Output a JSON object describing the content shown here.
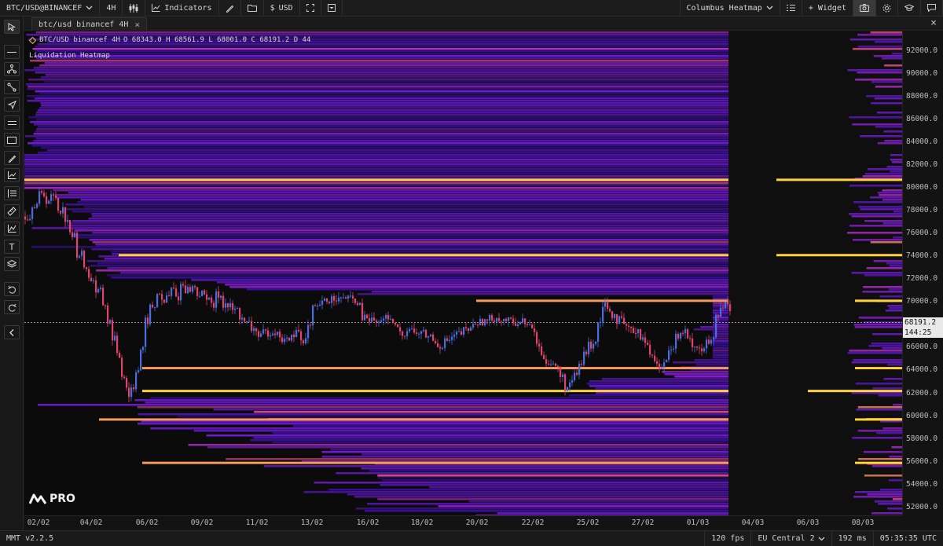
{
  "toolbar": {
    "symbol": "BTC/USD@BINANCEF",
    "timeframe": "4H",
    "indicators_label": "Indicators",
    "currency_label": "USD",
    "layout_name": "Columbus Heatmap",
    "widget_label": "+ Widget"
  },
  "tab": {
    "title": "btc/usd binancef 4H"
  },
  "legend": {
    "symbol": "BTC/USD binancef 4H",
    "ohlc": "O 68343.0  H 68561.9  L 68001.0  C 68191.2  D 44",
    "indicator_name": "Liquidation Heatmap"
  },
  "logo": {
    "text": "PRO"
  },
  "price_axis": {
    "ticks": [
      "92000.0",
      "90000.0",
      "88000.0",
      "86000.0",
      "84000.0",
      "82000.0",
      "80000.0",
      "78000.0",
      "76000.0",
      "74000.0",
      "72000.0",
      "70000.0",
      "68000.0",
      "66000.0",
      "64000.0",
      "62000.0",
      "60000.0",
      "58000.0",
      "56000.0",
      "54000.0",
      "52000.0"
    ],
    "current_price": "68191.2",
    "countdown": "144:25"
  },
  "time_axis": {
    "ticks": [
      "02/02",
      "04/02",
      "06/02",
      "09/02",
      "11/02",
      "13/02",
      "16/02",
      "18/02",
      "20/02",
      "22/02",
      "25/02",
      "27/02",
      "01/03",
      "04/03",
      "06/03",
      "08/03"
    ]
  },
  "status": {
    "version": "MMT v2.2.5",
    "fps": "120 fps",
    "region": "EU Central 2",
    "latency": "192 ms",
    "clock": "05:35:35 UTC"
  },
  "colors": {
    "up": "#4a6ee0",
    "down": "#e0446a",
    "heat_low": "#3a0fa0",
    "heat_mid": "#8a1fd0",
    "heat_high": "#e8508a",
    "heat_max": "#ffd23a"
  },
  "chart_data": {
    "type": "heatmap",
    "title": "Liquidation Heatmap",
    "y_range": [
      51300,
      93700
    ],
    "last_price": 68191.2,
    "key_liquidation_levels": [
      80700,
      74100,
      70100,
      64200,
      62200,
      59700,
      55900
    ],
    "candles_path": [
      [
        0,
        77500
      ],
      [
        8,
        78600
      ],
      [
        16,
        79400
      ],
      [
        24,
        78900
      ],
      [
        32,
        79200
      ],
      [
        40,
        78100
      ],
      [
        48,
        77300
      ],
      [
        56,
        75800
      ],
      [
        64,
        74200
      ],
      [
        72,
        73100
      ],
      [
        80,
        72000
      ],
      [
        88,
        70900
      ],
      [
        96,
        69800
      ],
      [
        104,
        68200
      ],
      [
        110,
        66900
      ],
      [
        116,
        65200
      ],
      [
        120,
        63600
      ],
      [
        126,
        62600
      ],
      [
        130,
        61800
      ],
      [
        134,
        62500
      ],
      [
        138,
        64100
      ],
      [
        144,
        65800
      ],
      [
        150,
        68300
      ],
      [
        158,
        69500
      ],
      [
        166,
        70800
      ],
      [
        172,
        69900
      ],
      [
        178,
        70500
      ],
      [
        184,
        71100
      ],
      [
        190,
        70400
      ],
      [
        196,
        71500
      ],
      [
        202,
        71100
      ],
      [
        210,
        71300
      ],
      [
        218,
        70700
      ],
      [
        226,
        70500
      ],
      [
        234,
        69600
      ],
      [
        242,
        70600
      ],
      [
        250,
        69800
      ],
      [
        256,
        69600
      ],
      [
        262,
        69300
      ],
      [
        270,
        68700
      ],
      [
        278,
        68100
      ],
      [
        286,
        67600
      ],
      [
        294,
        66900
      ],
      [
        302,
        67300
      ],
      [
        310,
        67400
      ],
      [
        318,
        67100
      ],
      [
        326,
        66600
      ],
      [
        334,
        66900
      ],
      [
        342,
        67500
      ],
      [
        350,
        66700
      ],
      [
        358,
        67800
      ],
      [
        364,
        69400
      ],
      [
        372,
        69800
      ],
      [
        380,
        70100
      ],
      [
        388,
        70400
      ],
      [
        396,
        70200
      ],
      [
        404,
        70400
      ],
      [
        412,
        70200
      ],
      [
        420,
        69600
      ],
      [
        428,
        68600
      ],
      [
        436,
        68400
      ],
      [
        444,
        68100
      ],
      [
        452,
        68600
      ],
      [
        460,
        68200
      ],
      [
        468,
        67800
      ],
      [
        476,
        67200
      ],
      [
        484,
        67700
      ],
      [
        492,
        67200
      ],
      [
        500,
        67300
      ],
      [
        508,
        67000
      ],
      [
        516,
        66600
      ],
      [
        524,
        66200
      ],
      [
        532,
        66600
      ],
      [
        540,
        66900
      ],
      [
        548,
        67200
      ],
      [
        556,
        67500
      ],
      [
        564,
        67900
      ],
      [
        572,
        68200
      ],
      [
        580,
        68300
      ],
      [
        588,
        68500
      ],
      [
        596,
        68600
      ],
      [
        604,
        68400
      ],
      [
        612,
        68300
      ],
      [
        620,
        68200
      ],
      [
        628,
        68300
      ],
      [
        636,
        67900
      ],
      [
        644,
        67500
      ],
      [
        650,
        66200
      ],
      [
        656,
        65200
      ],
      [
        662,
        64800
      ],
      [
        668,
        64600
      ],
      [
        674,
        64200
      ],
      [
        680,
        63400
      ],
      [
        686,
        62500
      ],
      [
        692,
        62800
      ],
      [
        698,
        63600
      ],
      [
        704,
        64500
      ],
      [
        710,
        65600
      ],
      [
        716,
        66200
      ],
      [
        722,
        66600
      ],
      [
        728,
        68300
      ],
      [
        734,
        69900
      ],
      [
        740,
        69400
      ],
      [
        746,
        68900
      ],
      [
        752,
        68400
      ],
      [
        760,
        67800
      ],
      [
        768,
        67400
      ],
      [
        776,
        67600
      ],
      [
        782,
        66900
      ],
      [
        788,
        66200
      ],
      [
        794,
        65600
      ],
      [
        800,
        64700
      ],
      [
        806,
        64100
      ],
      [
        812,
        64900
      ],
      [
        818,
        66100
      ],
      [
        826,
        67000
      ],
      [
        834,
        67400
      ],
      [
        840,
        66600
      ],
      [
        846,
        66300
      ],
      [
        852,
        66000
      ],
      [
        858,
        65800
      ],
      [
        864,
        66400
      ],
      [
        870,
        66600
      ],
      [
        876,
        68700
      ],
      [
        882,
        69400
      ],
      [
        888,
        69900
      ],
      [
        894,
        69500
      ],
      [
        897,
        68200
      ]
    ]
  }
}
